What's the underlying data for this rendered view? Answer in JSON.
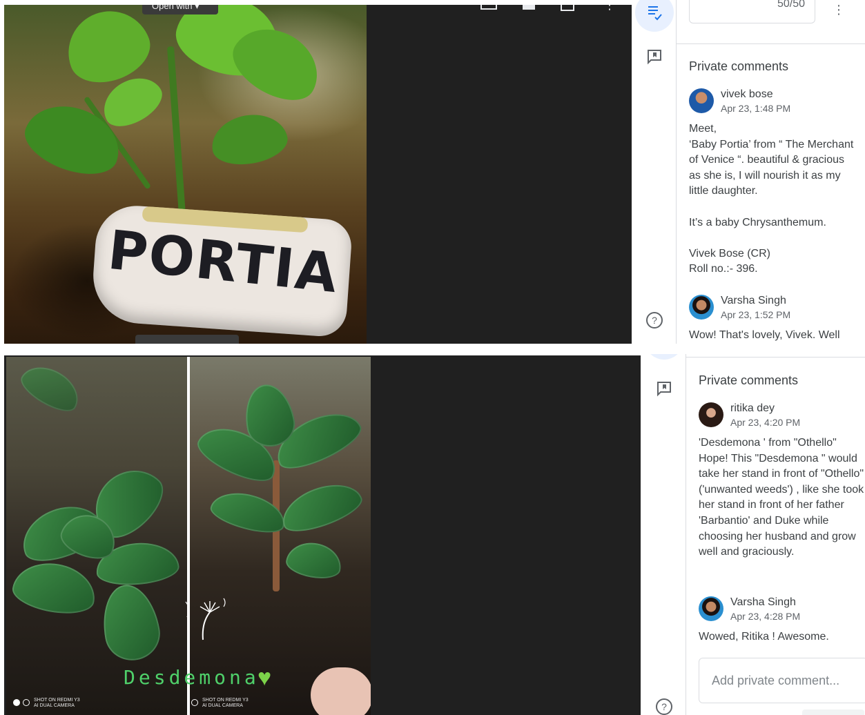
{
  "top": {
    "viewer": {
      "pager_label": "Open with"
    },
    "side_icons": [
      "rubric-icon",
      "comment-icon",
      "help-icon"
    ],
    "grade": {
      "value": "50/50"
    },
    "private_comments": {
      "title": "Private comments",
      "comments": [
        {
          "author": "vivek bose",
          "time": "Apr 23, 1:48 PM",
          "avatar_color": "#1e5aa8",
          "body": "Meet,\n‘Baby Portia’ from “ The Merchant of Venice “. beautiful & gracious as she is, I will nourish it as my little daughter.\n\nIt’s a baby Chrysanthemum.\n\nVivek Bose (CR)\nRoll no.:- 396."
        },
        {
          "author": "Varsha Singh",
          "time": "Apr 23, 1:52 PM",
          "avatar_color": "#2a8fd0",
          "body": "Wow! That's lovely, Vivek. Well"
        }
      ]
    },
    "photo": {
      "tag_text": "PORTIA"
    }
  },
  "bottom": {
    "side_icons": [
      "comment-icon",
      "help-icon"
    ],
    "private_comments": {
      "title": "Private comments",
      "comments": [
        {
          "author": "ritika dey",
          "time": "Apr 23, 4:20 PM",
          "avatar_color": "#3a2a24",
          "body": "'Desdemona ' from \"Othello\" Hope! This \"Desdemona \" would take her stand in front of \"Othello\" ('unwanted weeds') , like she took her stand in front of her father 'Barbantio' and Duke while choosing her husband and grow well and graciously."
        },
        {
          "author": "Varsha Singh",
          "time": "Apr 23, 4:28 PM",
          "avatar_color": "#2a8fd0",
          "body": "Wowed, Ritika ! Awesome."
        }
      ],
      "add_placeholder": "Add private comment..."
    },
    "photo": {
      "caption": "Desdemona",
      "watermark": "SHOT ON REDMI Y3\nAI DUAL CAMERA"
    }
  },
  "colors": {
    "accent": "#1a73e8",
    "viewer_bg": "#202020",
    "divider": "#dadce0"
  }
}
